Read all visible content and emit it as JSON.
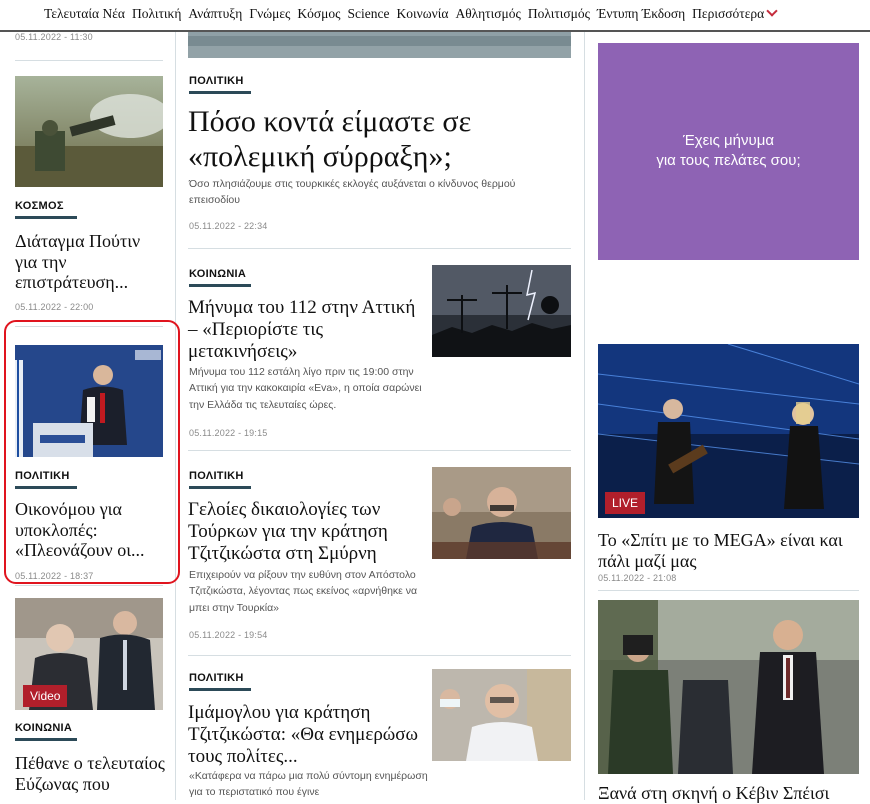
{
  "nav": {
    "items": [
      "Τελευταία Νέα",
      "Πολιτική",
      "Ανάπτυξη",
      "Γνώμες",
      "Κόσμος",
      "Science",
      "Κοινωνία",
      "Αθλητισμός",
      "Πολιτισμός",
      "Έντυπη Έκδοση"
    ],
    "more": "Περισσότερα"
  },
  "left": {
    "top_date": "05.11.2022 - 11:30",
    "a1": {
      "category": "ΚΟΣΜΟΣ",
      "title": "Διάταγμα Πούτιν για την επιστράτευση...",
      "date": "05.11.2022 - 22:00"
    },
    "a2": {
      "category": "ΠΟΛΙΤΙΚΗ",
      "title": "Οικονόμου για υποκλοπές: «Πλεονάζουν οι...",
      "date": "05.11.2022 - 18:37"
    },
    "a3": {
      "badge": "Video",
      "category": "ΚΟΙΝΩΝΙΑ",
      "title": "Πέθανε ο τελευταίος Εύζωνας που"
    }
  },
  "center": {
    "lead": {
      "category": "ΠΟΛΙΤΙΚΗ",
      "title": "Πόσο κοντά είμαστε σε «πολεμική σύρραξη»;",
      "excerpt": "Όσο πλησιάζουμε στις τουρκικές εκλογές αυξάνεται ο κίνδυνος θερμού επεισοδίου",
      "date": "05.11.2022 - 22:34"
    },
    "a2": {
      "category": "ΚΟΙΝΩΝΙΑ",
      "title": "Μήνυμα του 112 στην Αττική – «Περιορίστε τις μετακινήσεις»",
      "excerpt": "Μήνυμα του 112 εστάλη λίγο πριν τις 19:00 στην Αττική για την κακοκαιρία «Eva», η οποία σαρώνει την Ελλάδα τις τελευταίες ώρες.",
      "date": "05.11.2022 - 19:15"
    },
    "a3": {
      "category": "ΠΟΛΙΤΙΚΗ",
      "title": "Γελοίες δικαιολογίες των Τούρκων για την κράτηση Τζιτζικώστα στη Σμύρνη",
      "excerpt": "Επιχειρούν να ρίξουν την ευθύνη στον Απόστολο Τζιτζικώστα, λέγοντας πως εκείνος «αρνήθηκε να μπει στην Τουρκία»",
      "date": "05.11.2022 - 19:54"
    },
    "a4": {
      "category": "ΠΟΛΙΤΙΚΗ",
      "title": "Ιμάμογλου για κράτηση Τζιτζικώστα: «Θα ενημερώσω τους πολίτες...",
      "excerpt": "«Κατάφερα να πάρω μια πολύ σύντομη ενημέρωση για το περιστατικό που έγινε"
    }
  },
  "right": {
    "ad_line1": "Έχεις μήνυμα",
    "ad_line2": "για τους πελάτες σου;",
    "a1": {
      "badge": "LIVE",
      "title": "Το «Σπίτι με το MEGA» είναι και πάλι μαζί μας",
      "date": "05.11.2022 - 21:08"
    },
    "a2": {
      "title": "Ξανά στη σκηνή ο Κέβιν Σπέισι"
    }
  },
  "colors": {
    "accent_red": "#c52c3c",
    "category_bar": "#2c4a58",
    "ad_purple": "#8e63b4",
    "badge_red": "#b11f2b",
    "highlight_box": "#e0141e"
  }
}
